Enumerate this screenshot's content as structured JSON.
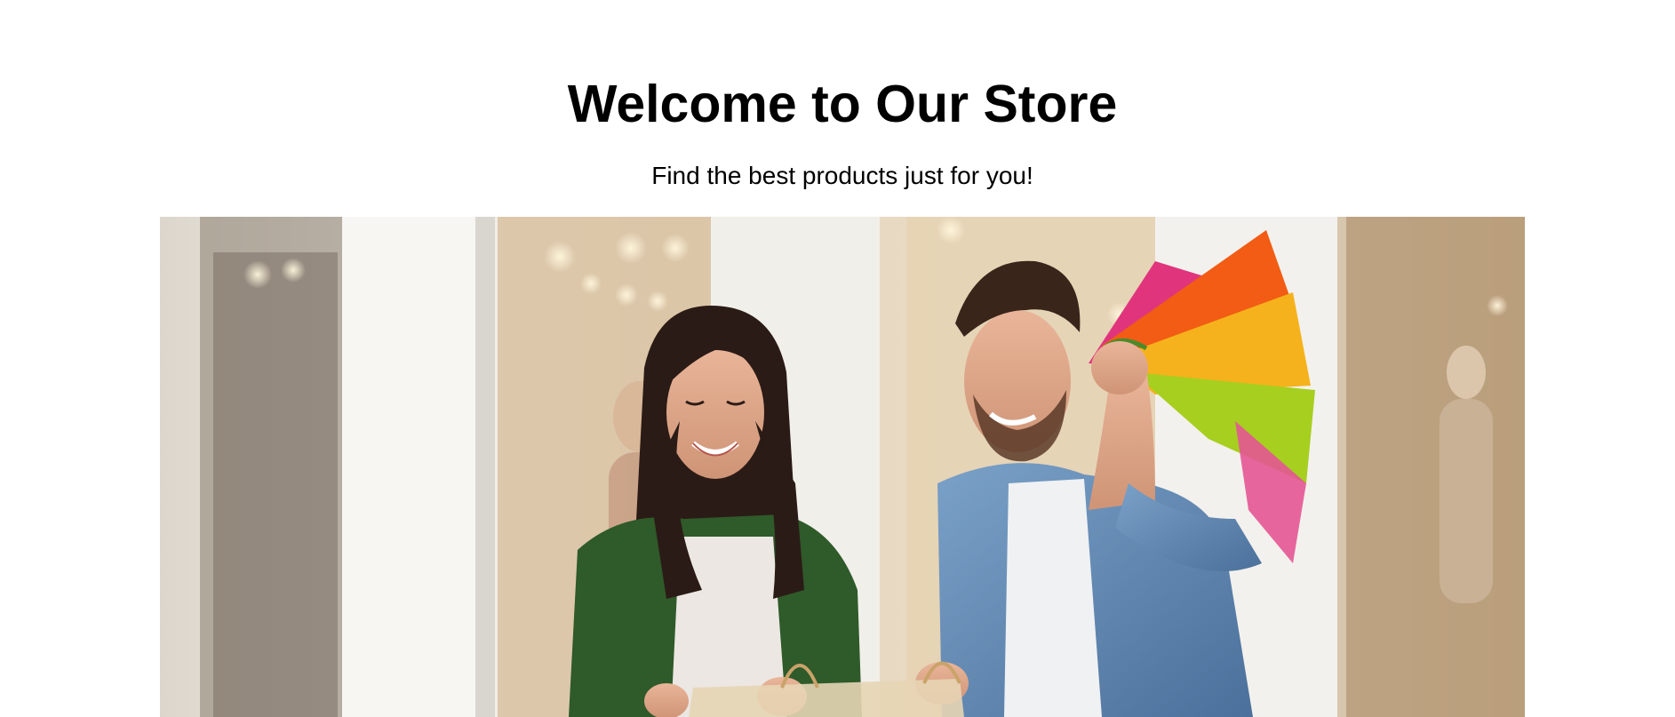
{
  "header": {
    "title": "Welcome to Our Store",
    "subtitle": "Find the best products just for you!"
  },
  "hero": {
    "alt": "Smiling couple with colorful shopping bags",
    "colors": {
      "bag_orange": "#f25c14",
      "bag_yellow": "#f5b21c",
      "bag_green": "#a6cf1f",
      "bag_pink": "#e0357d",
      "jacket_green": "#2f5a2a",
      "denim": "#5d85b1"
    }
  }
}
